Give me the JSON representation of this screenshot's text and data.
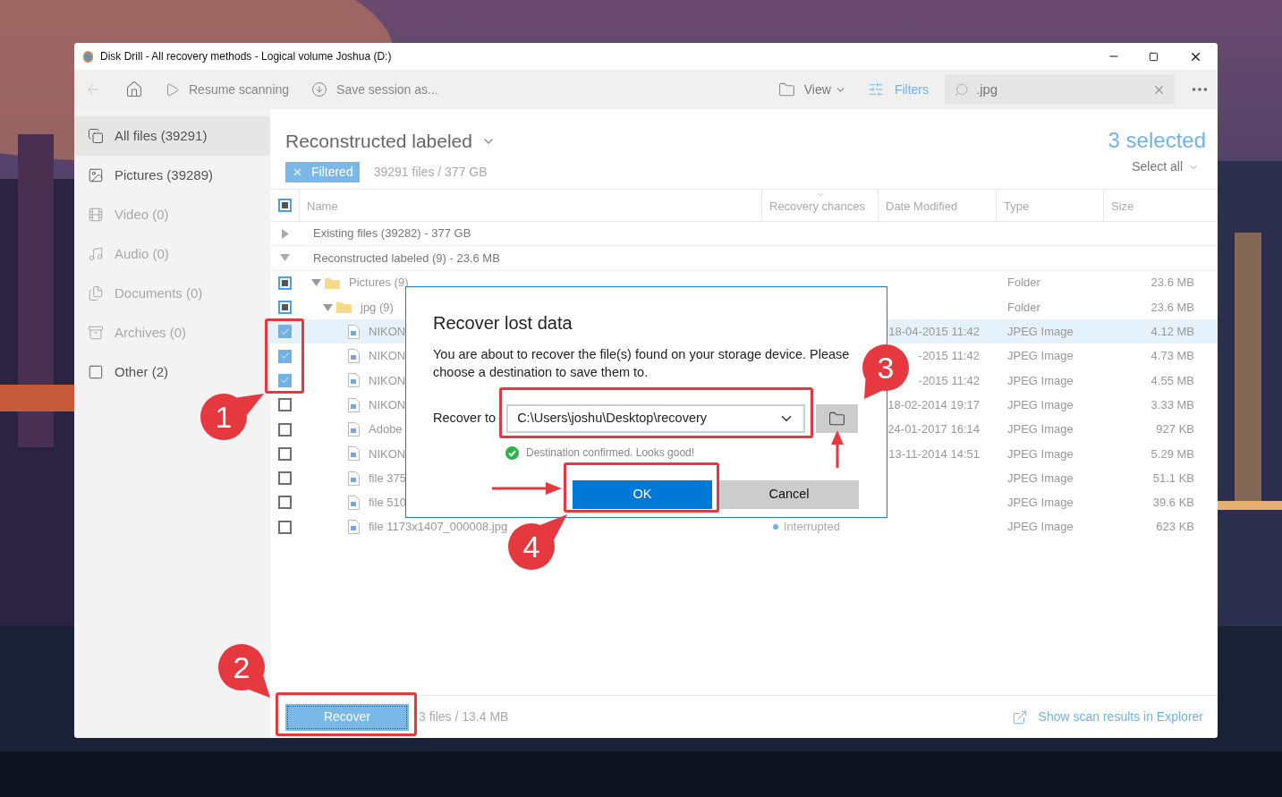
{
  "window": {
    "title": "Disk Drill - All recovery methods - Logical volume Joshua (D:)"
  },
  "toolbar": {
    "back_disabled": true,
    "resume": "Resume scanning",
    "save": "Save session as...",
    "view": "View",
    "filters": "Filters",
    "search": {
      "value": ".jpg"
    }
  },
  "sidebar": {
    "items": [
      {
        "label": "All files (39291)",
        "kind": "all",
        "selected": true,
        "disabled": false
      },
      {
        "label": "Pictures (39289)",
        "kind": "pictures",
        "selected": false,
        "disabled": false
      },
      {
        "label": "Video (0)",
        "kind": "video",
        "selected": false,
        "disabled": true
      },
      {
        "label": "Audio (0)",
        "kind": "audio",
        "selected": false,
        "disabled": true
      },
      {
        "label": "Documents (0)",
        "kind": "documents",
        "selected": false,
        "disabled": true
      },
      {
        "label": "Archives (0)",
        "kind": "archives",
        "selected": false,
        "disabled": true
      },
      {
        "label": "Other (2)",
        "kind": "other",
        "selected": false,
        "disabled": false
      }
    ]
  },
  "header": {
    "title": "Reconstructed labeled",
    "filter_tag": "Filtered",
    "summary": "39291 files / 377 GB",
    "selection": "3 selected",
    "select_all": "Select all"
  },
  "table": {
    "select_all": {
      "partial": true
    },
    "columns": [
      "Name",
      "Recovery chances",
      "Date Modified",
      "Type",
      "Size"
    ],
    "groups": [
      {
        "label": "Existing files (39282) - 377 GB",
        "expanded": false
      },
      {
        "label": "Reconstructed labeled (9) - 23.6 MB",
        "expanded": true,
        "children": [
          {
            "name": "Pictures (9)",
            "kind": "folder",
            "partial": true,
            "expanded": true,
            "type": "Folder",
            "size": "23.6 MB",
            "children": [
              {
                "name": "jpg (9)",
                "kind": "folder",
                "partial": true,
                "expanded": true,
                "type": "Folder",
                "size": "23.6 MB",
                "children": [
                  {
                    "name": "NIKON",
                    "kind": "file",
                    "checked": true,
                    "selected": true,
                    "date": "18-04-2015 11:42",
                    "type": "JPEG Image",
                    "size": "4.12 MB"
                  },
                  {
                    "name": "NIKON",
                    "kind": "file",
                    "checked": true,
                    "selected": false,
                    "date": "-2015 11:42",
                    "type": "JPEG Image",
                    "size": "4.73 MB"
                  },
                  {
                    "name": "NIKON",
                    "kind": "file",
                    "checked": true,
                    "selected": false,
                    "date": "-2015 11:42",
                    "type": "JPEG Image",
                    "size": "4.55 MB"
                  },
                  {
                    "name": "NIKON",
                    "kind": "file",
                    "checked": false,
                    "selected": false,
                    "date": "18-02-2014 19:17",
                    "type": "JPEG Image",
                    "size": "3.33 MB"
                  },
                  {
                    "name": "Adobe",
                    "kind": "file",
                    "checked": false,
                    "selected": false,
                    "date": "24-01-2017 16:14",
                    "type": "JPEG Image",
                    "size": "927 KB"
                  },
                  {
                    "name": "NIKON",
                    "kind": "file",
                    "checked": false,
                    "selected": false,
                    "date": "13-11-2014 14:51",
                    "type": "JPEG Image",
                    "size": "5.29 MB"
                  },
                  {
                    "name": "file 375",
                    "kind": "file",
                    "checked": false,
                    "selected": false,
                    "type": "JPEG Image",
                    "size": "51.1 KB"
                  },
                  {
                    "name": "file 510",
                    "kind": "file",
                    "checked": false,
                    "selected": false,
                    "type": "JPEG Image",
                    "size": "39.6 KB"
                  },
                  {
                    "name": "file 1173x1407_000008.jpg",
                    "kind": "file",
                    "checked": false,
                    "selected": false,
                    "recovery": "Interrupted",
                    "type": "JPEG Image",
                    "size": "623 KB"
                  }
                ]
              }
            ]
          }
        ]
      }
    ]
  },
  "dialog": {
    "title": "Recover lost data",
    "message": "You are about to recover the file(s) found on your storage device. Please choose a destination to save them to.",
    "label": "Recover to",
    "destination": {
      "value": "C:\\Users\\joshu\\Desktop\\recovery"
    },
    "status": "Destination confirmed. Looks good!",
    "buttons": [
      {
        "label": "OK",
        "kind": "primary"
      },
      {
        "label": "Cancel",
        "kind": "secondary"
      }
    ]
  },
  "footer": {
    "recover": "Recover",
    "summary": "3 files / 13.4 MB",
    "explorer_link": "Show scan results in Explorer"
  },
  "annotations": [
    {
      "label": "1"
    },
    {
      "label": "2"
    },
    {
      "label": "3"
    },
    {
      "label": "4"
    }
  ]
}
